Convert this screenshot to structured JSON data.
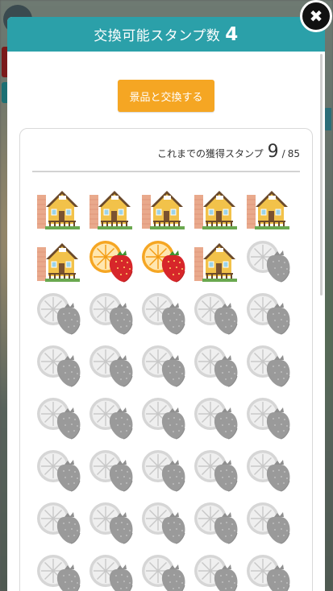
{
  "header": {
    "title": "交換可能スタンプ数",
    "exchangeable_count": "4"
  },
  "exchange_button_label": "景品と交換する",
  "close_icon": "close-icon",
  "stamp_card": {
    "label": "これまでの獲得スタンプ",
    "earned": "9",
    "separator": "/",
    "total": "85",
    "visible_stamps": [
      "house",
      "house",
      "house",
      "house",
      "house",
      "house",
      "orange-strawberry",
      "orange-strawberry",
      "house",
      "empty",
      "empty",
      "empty",
      "empty",
      "empty",
      "empty",
      "empty",
      "empty",
      "empty",
      "empty",
      "empty",
      "empty",
      "empty",
      "empty",
      "empty",
      "empty",
      "empty",
      "empty",
      "empty",
      "empty",
      "empty",
      "empty",
      "empty",
      "empty",
      "empty",
      "empty",
      "empty",
      "empty",
      "empty",
      "empty",
      "empty"
    ]
  },
  "colors": {
    "header": "#2ba0a9",
    "button": "#f5a623",
    "empty_stamp": "#a8a8a8"
  }
}
